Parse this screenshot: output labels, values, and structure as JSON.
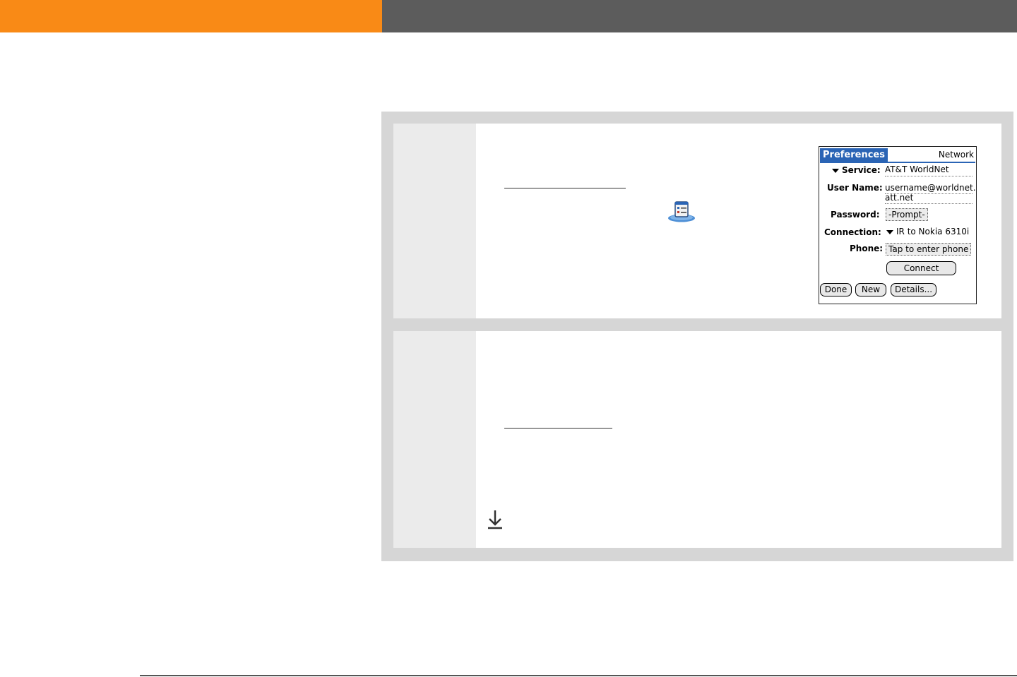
{
  "palm": {
    "title": "Preferences",
    "pane": "Network",
    "fields": {
      "service_label": "Service:",
      "service_value": "AT&T WorldNet",
      "username_label": "User Name:",
      "username_line1": "username@worldnet.",
      "username_line2": "att.net",
      "password_label": "Password:",
      "password_value": "-Prompt-",
      "connection_label": "Connection:",
      "connection_value": "IR to Nokia 6310i",
      "phone_label": "Phone:",
      "phone_value": "Tap to enter phone"
    },
    "buttons": {
      "connect": "Connect",
      "done": "Done",
      "new": "New",
      "details": "Details..."
    }
  },
  "icons": {
    "prefs_app": "prefs-app-icon",
    "scroll_down": "down-arrow-icon"
  },
  "colors": {
    "header_orange": "#f98a16",
    "header_gray": "#5c5c5c",
    "palm_blue": "#2a64b5"
  }
}
